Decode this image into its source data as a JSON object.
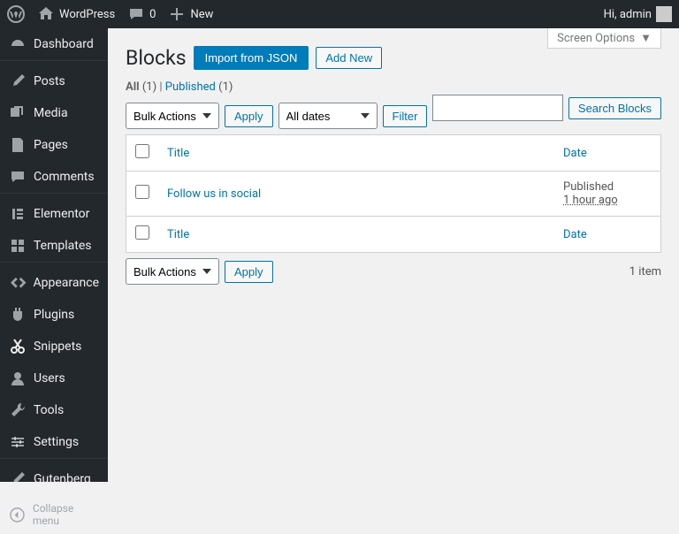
{
  "adminBar": {
    "siteName": "WordPress",
    "comments": "0",
    "new": "New",
    "greeting": "Hi, admin"
  },
  "sidebar": {
    "items": [
      {
        "label": "Dashboard"
      },
      {
        "label": "Posts"
      },
      {
        "label": "Media"
      },
      {
        "label": "Pages"
      },
      {
        "label": "Comments"
      },
      {
        "label": "Elementor"
      },
      {
        "label": "Templates"
      },
      {
        "label": "Appearance"
      },
      {
        "label": "Plugins"
      },
      {
        "label": "Snippets"
      },
      {
        "label": "Users"
      },
      {
        "label": "Tools"
      },
      {
        "label": "Settings"
      },
      {
        "label": "Gutenberg"
      }
    ],
    "collapse": "Collapse menu"
  },
  "screenOptions": "Screen Options",
  "page": {
    "title": "Blocks",
    "importBtn": "Import from JSON",
    "addNewBtn": "Add New"
  },
  "views": {
    "allLabel": "All",
    "allCount": "(1)",
    "publishedLabel": "Published",
    "publishedCount": "(1)",
    "sep": " | "
  },
  "search": {
    "button": "Search Blocks"
  },
  "tablenav": {
    "bulkActions": "Bulk Actions",
    "apply": "Apply",
    "allDates": "All dates",
    "filter": "Filter",
    "itemCount": "1 item"
  },
  "table": {
    "colTitle": "Title",
    "colDate": "Date",
    "rows": [
      {
        "title": "Follow us in social",
        "status": "Published",
        "time": "1 hour ago"
      }
    ]
  }
}
